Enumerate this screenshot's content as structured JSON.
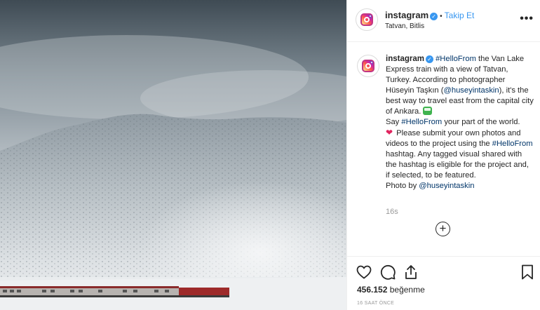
{
  "post": {
    "username": "instagram",
    "follow_label": "Takip Et",
    "location": "Tatvan, Bitlis",
    "more_label": "•••"
  },
  "caption": {
    "username": "instagram",
    "tag1": "#HelloFrom",
    "text1": " the Van Lake Express train with a view of Tatvan, Turkey. According to photographer Hüseyin Taşkın (",
    "mention1": "@huseyintaskin",
    "text2": "), it's the best way to travel east from the capital city of Ankara.",
    "line_say": "Say ",
    "tag2": "#HelloFrom",
    "text3": " your part of the world.",
    "text4": " Please submit your own photos and videos to the project using the ",
    "tag3": "#HelloFrom",
    "text5": " hashtag. Any tagged visual shared with the hashtag is eligible for the project and, if selected, to be featured.",
    "photo_by": "Photo by ",
    "mention2": "@huseyintaskin",
    "time_ago": "16s"
  },
  "stats": {
    "likes_count": "456.152",
    "likes_word": "beğenme",
    "timestamp": "16 SAAT ÖNCE"
  },
  "icons": [
    "verified-icon",
    "heart-icon",
    "comment-icon",
    "share-icon",
    "bookmark-icon",
    "plus-circle-icon",
    "train-emoji",
    "heart-emoji"
  ],
  "colors": {
    "link": "#003569",
    "follow": "#3897f0",
    "muted": "#999999"
  }
}
